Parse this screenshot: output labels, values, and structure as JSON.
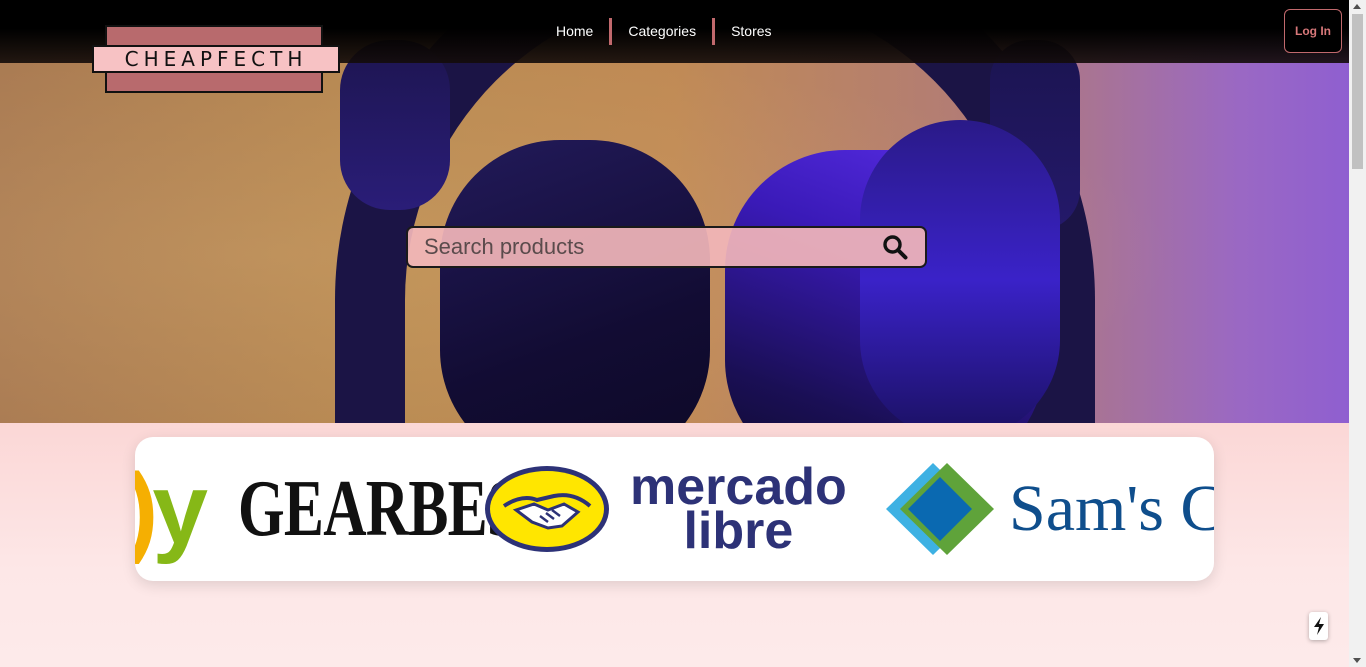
{
  "header": {
    "logo_text": "CHEAPFECTH",
    "nav": [
      {
        "label": "Home"
      },
      {
        "label": "Categories"
      },
      {
        "label": "Stores"
      }
    ],
    "login_label": "Log In"
  },
  "hero": {
    "search": {
      "placeholder": "Search products",
      "value": ""
    },
    "search_icon": "search-icon"
  },
  "stores_carousel": {
    "logos": [
      {
        "name": "ebay",
        "text": "y"
      },
      {
        "name": "gearbest",
        "text": "GEARBEST"
      },
      {
        "name": "mercado-libre",
        "line1": "mercado",
        "line2": "libre"
      },
      {
        "name": "sams-club",
        "text": "Sam's Cl"
      }
    ]
  },
  "colors": {
    "accent": "#c1696d",
    "logo_pink": "#f7c2c4",
    "logo_rose": "#b86a6d",
    "search_bg": "#f2b6ba",
    "page_bg": "#fde4e4"
  },
  "floating": {
    "icon": "lightning-icon"
  }
}
